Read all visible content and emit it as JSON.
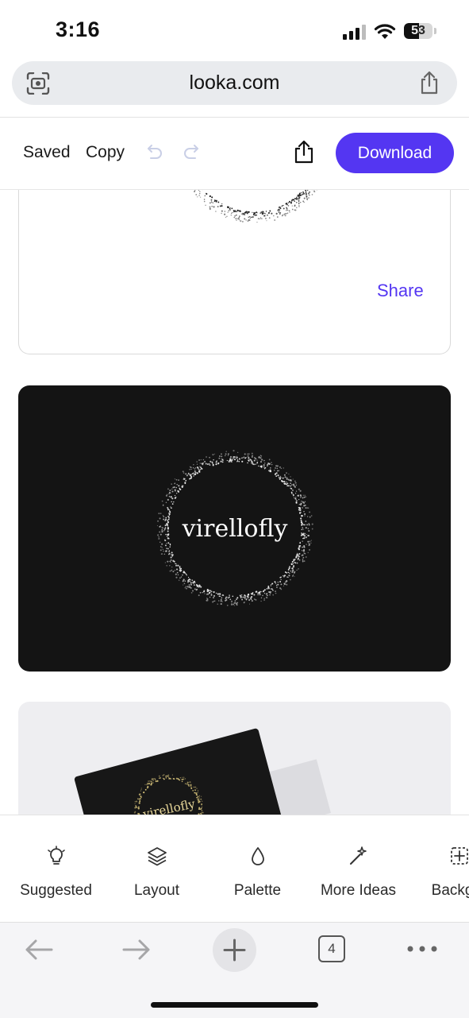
{
  "status": {
    "time": "3:16",
    "battery": "53",
    "battery_level": 0.53
  },
  "browser": {
    "url": "looka.com",
    "tab_count": "4",
    "icons": [
      "lens-icon",
      "share-icon",
      "back-icon",
      "forward-icon",
      "plus-icon",
      "tabs-icon",
      "more-icon"
    ]
  },
  "toolbar": {
    "saved_label": "Saved",
    "copy_label": "Copy",
    "download_label": "Download"
  },
  "content": {
    "logo_text": "virellofly",
    "share_label": "Share",
    "colors": {
      "accent": "#5436F2",
      "dark_card": "#141414"
    }
  },
  "bottom_tabs": [
    {
      "label": "Suggested",
      "icon": "lightbulb-icon"
    },
    {
      "label": "Layout",
      "icon": "layers-icon"
    },
    {
      "label": "Palette",
      "icon": "droplet-icon"
    },
    {
      "label": "More Ideas",
      "icon": "magic-wand-icon"
    },
    {
      "label": "Backgro",
      "icon": "grid-icon"
    }
  ]
}
